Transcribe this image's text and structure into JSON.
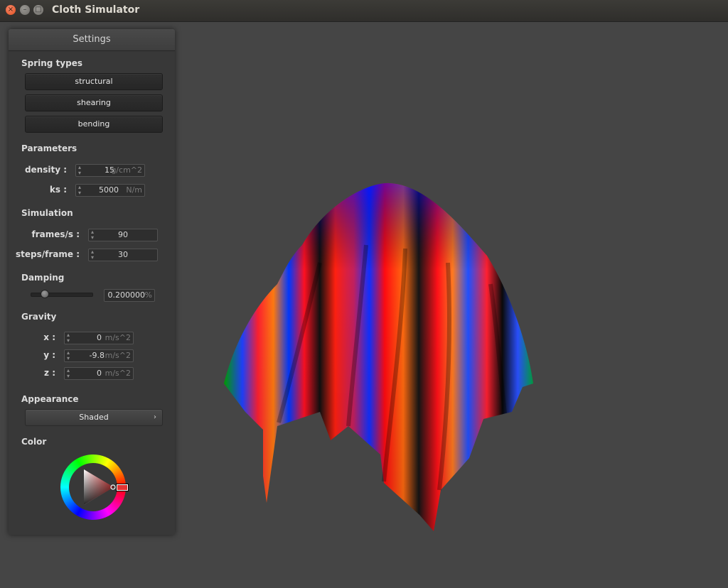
{
  "window": {
    "title": "Cloth Simulator",
    "close_glyph": "×",
    "minimize_glyph": "–",
    "maximize_glyph": "□"
  },
  "panel": {
    "title": "Settings",
    "spring_types": {
      "heading": "Spring types",
      "buttons": [
        "structural",
        "shearing",
        "bending"
      ]
    },
    "parameters": {
      "heading": "Parameters",
      "density": {
        "label": "density :",
        "value": "15",
        "unit": "g/cm^2"
      },
      "ks": {
        "label": "ks :",
        "value": "5000",
        "unit": "N/m"
      }
    },
    "simulation": {
      "heading": "Simulation",
      "fps": {
        "label": "frames/s :",
        "value": "90"
      },
      "steps": {
        "label": "steps/frame :",
        "value": "30"
      }
    },
    "damping": {
      "heading": "Damping",
      "value": "0.200000",
      "unit": "%"
    },
    "gravity": {
      "heading": "Gravity",
      "x": {
        "label": "x :",
        "value": "0",
        "unit": "m/s^2"
      },
      "y": {
        "label": "y :",
        "value": "-9.8",
        "unit": "m/s^2"
      },
      "z": {
        "label": "z :",
        "value": "0",
        "unit": "m/s^2"
      }
    },
    "appearance": {
      "heading": "Appearance",
      "selected": "Shaded",
      "chevron": "›"
    },
    "color": {
      "heading": "Color",
      "selected_color": "#e23333"
    }
  },
  "viewport": {
    "background": "#454545"
  }
}
